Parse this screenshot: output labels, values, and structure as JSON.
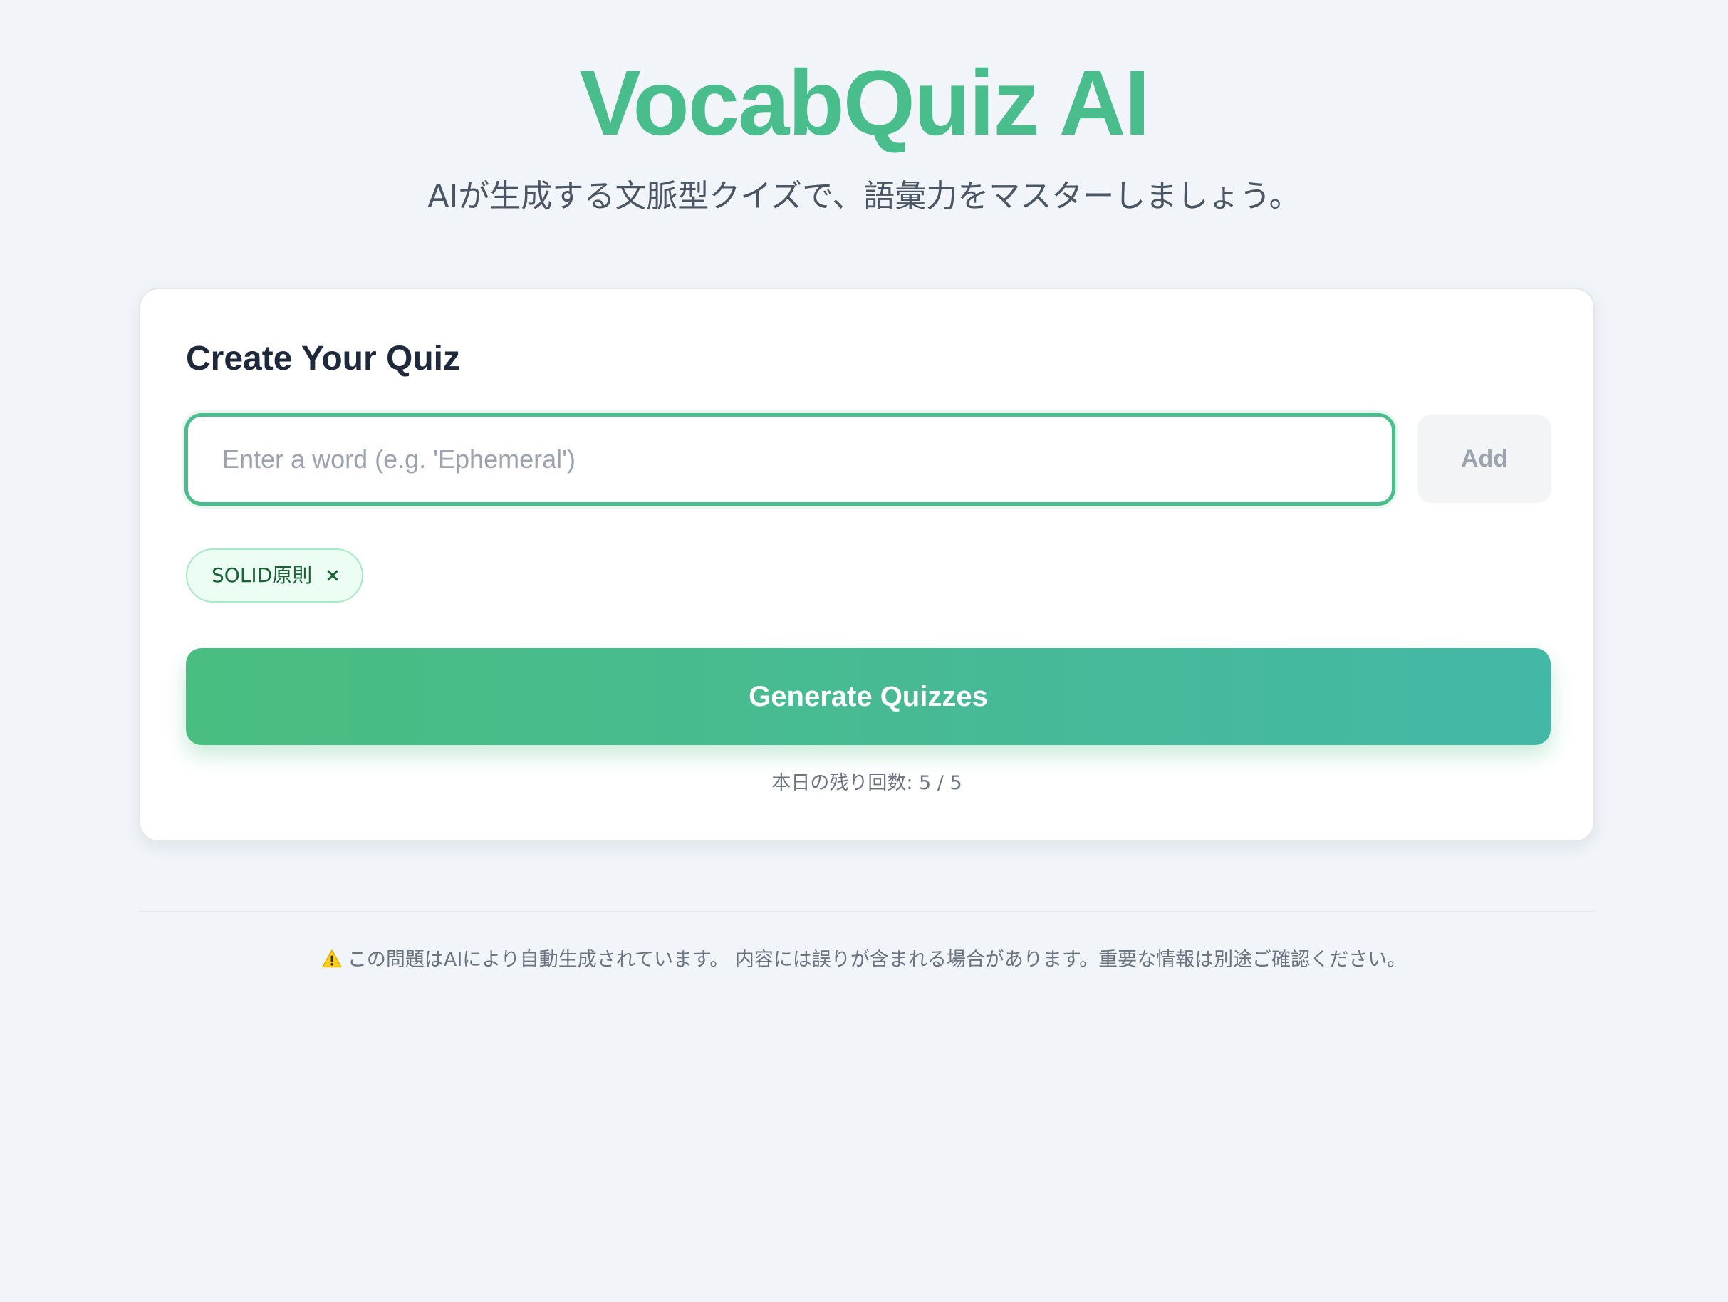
{
  "header": {
    "title": "VocabQuiz AI",
    "subtitle": "AIが生成する文脈型クイズで、語彙力をマスターしましょう。"
  },
  "quiz_card": {
    "title": "Create Your Quiz",
    "word_input": {
      "value": "",
      "placeholder": "Enter a word (e.g. 'Ephemeral')"
    },
    "add_button_label": "Add",
    "tags": [
      {
        "label": "SOLID原則",
        "remove_label": "×"
      }
    ],
    "generate_button_label": "Generate Quizzes",
    "quota_text": "本日の残り回数: 5 / 5"
  },
  "footer": {
    "warning_icon": "warning-icon",
    "disclaimer": "この問題はAIにより自動生成されています。 内容には誤りが含まれる場合があります。重要な情報は別途ご確認ください。"
  },
  "colors": {
    "accent": "#4abd8c",
    "gradient_start": "#4abd80",
    "gradient_end": "#44b8a6",
    "background": "#f1f5f9",
    "tag_background": "#ecfdf3",
    "tag_text": "#166534"
  }
}
